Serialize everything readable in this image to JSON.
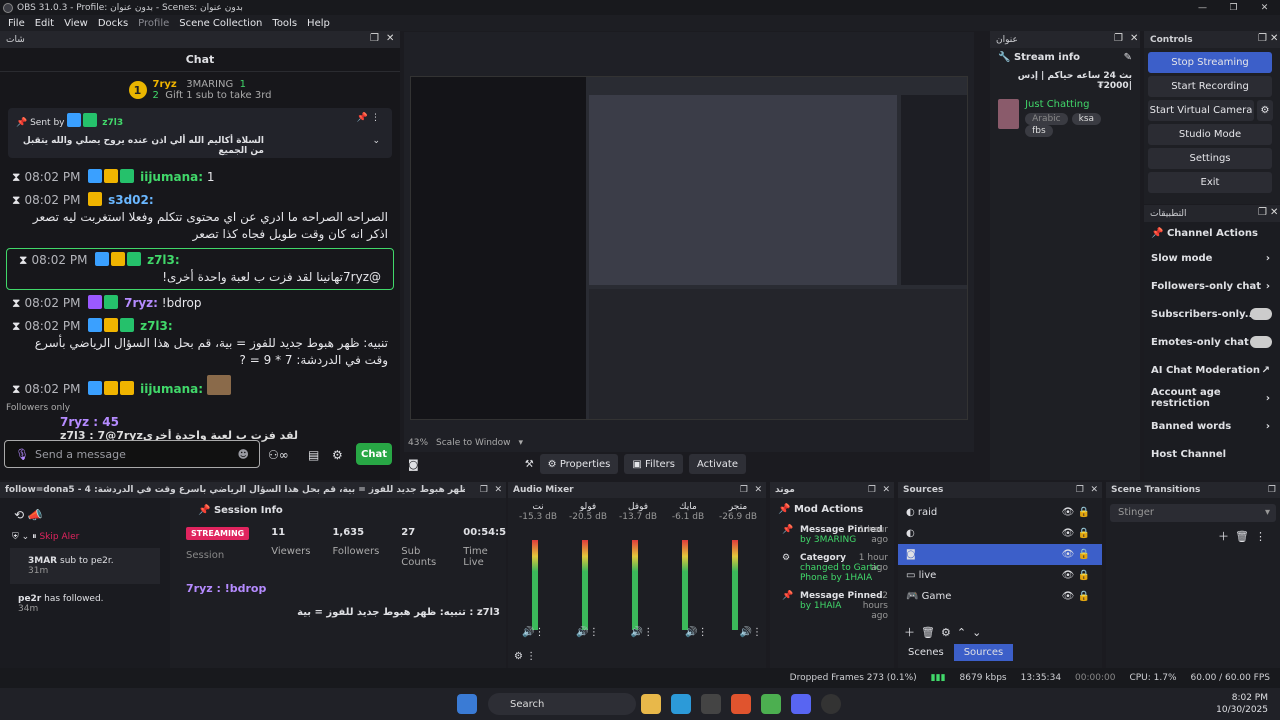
{
  "window": {
    "title": "OBS 31.0.3 - Profile: بدون عنوان - Scenes: بدون عنوان"
  },
  "menu": [
    "File",
    "Edit",
    "View",
    "Docks",
    "Profile",
    "Scene Collection",
    "Tools",
    "Help"
  ],
  "chat_dock": {
    "dock_title": "شات",
    "header": "Chat",
    "leaderboard": {
      "rank1": "1",
      "user1": "7ryz",
      "rank2": "2",
      "user2": "3MARING",
      "count": "1",
      "gift": "Gift 1 sub to take 3rd"
    },
    "pinned": {
      "sent_by": "Sent by",
      "user": "z7l3",
      "text": "السلاة أكاليم الله ألي اذن عنده يروح يصلي والله يتقبل من الجميع"
    },
    "messages": [
      {
        "time": "08:02 PM",
        "user": "iijumana:",
        "text": "1"
      },
      {
        "time": "08:02 PM",
        "user": "s3d02:",
        "text": "الصراحه الصراحه ما ادري عن اي محتوى تتكلم وفعلا استغربت ليه تصعر اذكر انه كان وقت طويل فجاه كذا تصعر"
      },
      {
        "time": "08:02 PM",
        "user": "z7l3:",
        "text": "@7ryzتهانينا لقد فزت ب لعبة واحدة أخرى!"
      },
      {
        "time": "08:02 PM",
        "user": "7ryz:",
        "text": "!bdrop"
      },
      {
        "time": "08:02 PM",
        "user": "z7l3:",
        "text": "تنبيه: ظهر هبوط جديد للفوز = بية، قم بحل هذا السؤال الرياضي بأسرع وقت في الدردشة: 7 * 9 = ?"
      },
      {
        "time": "08:02 PM",
        "user": "iijumana:",
        "text": ""
      }
    ],
    "overlay": {
      "followers_only": "Followers only",
      "line1": "7ryz : 45",
      "line2": "z7l3 : 7@7ryzلقد فزت ب لعبة واحدة أخرى",
      "line3": "7ryz : !bdrop",
      "line4": "z7l3 : تنبيه: ظهر هبوط جديد للفوز = بية"
    },
    "composer_placeholder": "Send a message",
    "chat_button": "Chat"
  },
  "preview": {
    "zoom": "43%",
    "scale": "Scale to Window",
    "properties": "Properties",
    "filters": "Filters",
    "activate": "Activate"
  },
  "stream_info": {
    "dock_title": "عنوان",
    "title": "Stream info",
    "stream_title": "بث 24 ساعه حياكم | إدس |2000₮",
    "category": "Just Chatting",
    "tags": [
      "Arabic",
      "ksa",
      "fbs"
    ]
  },
  "controls": {
    "title": "Controls",
    "buttons": [
      "Stop Streaming",
      "Start Recording",
      "Start Virtual Camera",
      "Studio Mode",
      "Settings",
      "Exit"
    ]
  },
  "channel_actions": {
    "dock_title": "التطبيقات",
    "title": "Channel Actions",
    "items": [
      "Slow mode",
      "Followers-only chat",
      "Subscribers-only...",
      "Emotes-only chat",
      "AI Chat Moderation",
      "Account age restriction",
      "Banned words",
      "Host Channel"
    ]
  },
  "follow_dock": {
    "title": "follow=dona5 - 4 :تنبيه: ظهر هبوط جديد للفوز = بية، قم بحل هذا السؤال الرياضي بأسرع وقت في الدردشة: ?",
    "skip_alert": "Skip Aler",
    "events": [
      {
        "user": "3MAR",
        "text": "sub to pe2r.",
        "age": "31m"
      },
      {
        "user": "pe2r",
        "text": "has followed.",
        "age": "34m"
      }
    ]
  },
  "session_info": {
    "title": "Session Info",
    "status": "STREAMING",
    "viewers": "11",
    "viewers_label": "Viewers",
    "followers": "1,635",
    "followers_label": "Followers",
    "subs": "27",
    "subs_label": "Sub Counts",
    "time": "00:54:57",
    "time_label": "Time Live",
    "session_label": "Session"
  },
  "audio_mixer": {
    "title": "Audio Mixer",
    "channels": [
      {
        "name": "نت",
        "db": "-15.3 dB"
      },
      {
        "name": "فولو",
        "db": "-20.5 dB"
      },
      {
        "name": "فوفل",
        "db": "-13.7 dB"
      },
      {
        "name": "مايك",
        "db": "-6.1 dB"
      },
      {
        "name": "متجر",
        "db": "-26.9 dB"
      }
    ],
    "scale": [
      "0",
      "-5",
      "-10",
      "-15",
      "-20",
      "-25",
      "-30",
      "-35",
      "-40",
      "-45",
      "-50",
      "-55",
      "-60"
    ]
  },
  "mod_actions": {
    "dock_title": "موند",
    "title": "Mod Actions",
    "items": [
      {
        "title": "Message Pinned",
        "detail": "by 3MARING",
        "age": "1 hour ago"
      },
      {
        "title": "Category",
        "detail": "changed to Gartic Phone by 1HAIA",
        "age": "1 hour ago"
      },
      {
        "title": "Message Pinned",
        "detail": "by 1HAIA",
        "age": "2 hours ago"
      }
    ]
  },
  "sources": {
    "title": "Sources",
    "items": [
      "raid",
      "",
      "",
      "live",
      "Game"
    ],
    "tabs": [
      "Scenes",
      "Sources"
    ]
  },
  "scene_transitions": {
    "title": "Scene Transitions",
    "selected": "Stinger"
  },
  "status_bar": {
    "dropped": "Dropped Frames 273 (0.1%)",
    "bitrate": "8679 kbps",
    "stream_time": "13:35:34",
    "rec_time": "00:00:00",
    "cpu": "CPU: 1.7%",
    "fps": "60.00 / 60.00 FPS"
  },
  "taskbar": {
    "search": "Search",
    "time": "8:02 PM",
    "date": "10/30/2025"
  },
  "colors": {
    "accent": "#3c5fc9",
    "chat_green": "#28a745",
    "streaming_red": "#e0245e"
  }
}
